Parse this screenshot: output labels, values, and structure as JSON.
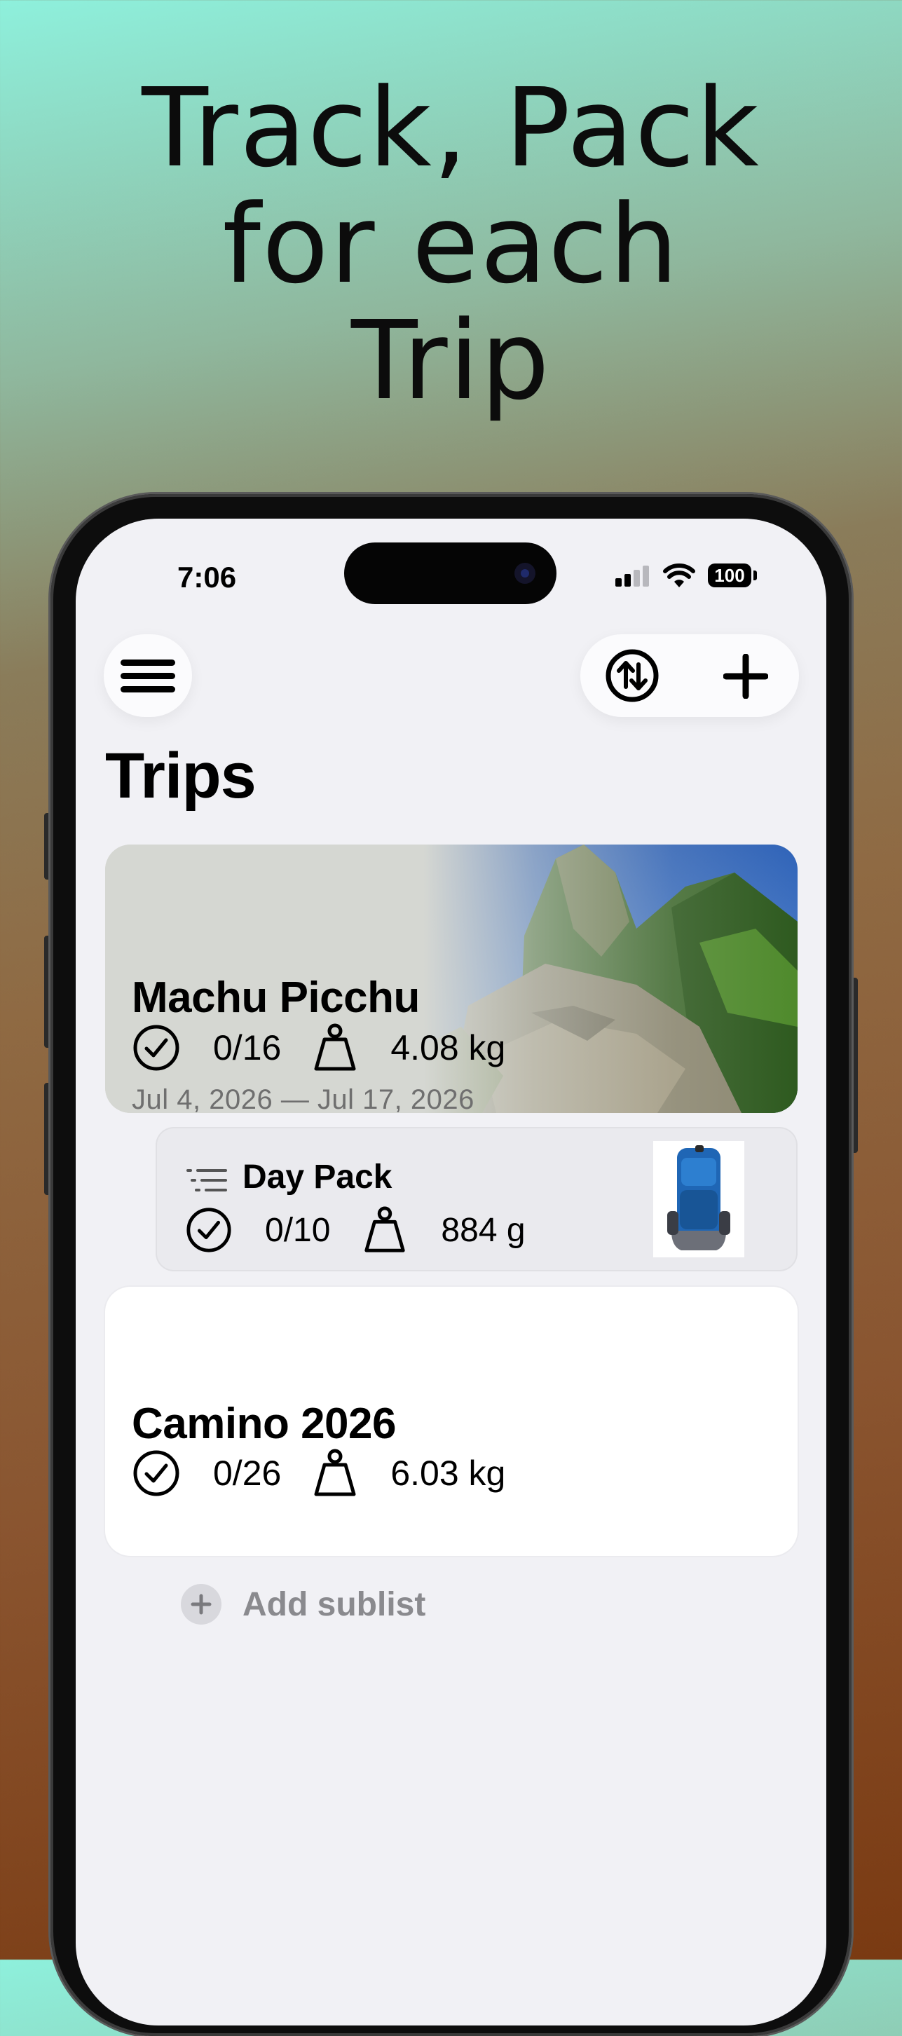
{
  "headline": {
    "lines": [
      "Track, Pack",
      "for each",
      "Trip"
    ]
  },
  "status_bar": {
    "time": "7:06",
    "battery": "100"
  },
  "toolbar": {
    "menu_icon": "hamburger-icon",
    "sort_icon": "sort-arrows-icon",
    "add_icon": "plus-icon"
  },
  "page": {
    "title": "Trips"
  },
  "trips": [
    {
      "name": "Machu Picchu",
      "packed": "0/16",
      "weight": "4.08 kg",
      "dates": "Jul 4, 2026 — Jul 17, 2026"
    },
    {
      "name": "Camino 2026",
      "packed": "0/26",
      "weight": "6.03 kg"
    }
  ],
  "sublist": {
    "name": "Day Pack",
    "packed": "0/10",
    "weight": "884 g"
  },
  "add_sublist": {
    "label": "Add sublist"
  },
  "colors": {
    "accent_gray": "#8a8a8e",
    "screen_bg": "#f1f1f5"
  }
}
